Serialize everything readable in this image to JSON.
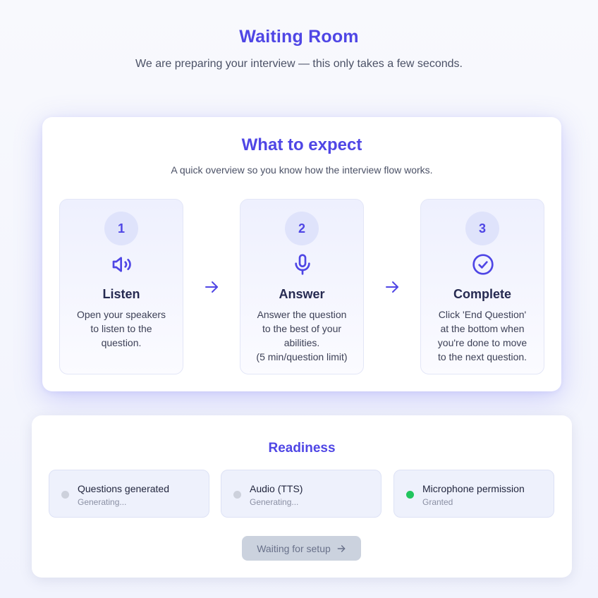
{
  "header": {
    "title": "Waiting Room",
    "subtitle": "We are preparing your interview — this only takes a few seconds."
  },
  "expect": {
    "title": "What to expect",
    "subtitle": "A quick overview so you know how the interview flow works.",
    "steps": [
      {
        "number": "1",
        "icon": "speaker-icon",
        "title": "Listen",
        "description": "Open your speakers\nto listen to the\nquestion."
      },
      {
        "number": "2",
        "icon": "microphone-icon",
        "title": "Answer",
        "description": "Answer the question\nto the best of your\nabilities.\n(5 min/question limit)"
      },
      {
        "number": "3",
        "icon": "check-circle-icon",
        "title": "Complete",
        "description": "Click 'End Question'\nat the bottom when\nyou're done to move\nto the next question."
      }
    ]
  },
  "readiness": {
    "title": "Readiness",
    "items": [
      {
        "label": "Questions generated",
        "status": "Generating...",
        "state": "pending"
      },
      {
        "label": "Audio (TTS)",
        "status": "Generating...",
        "state": "pending"
      },
      {
        "label": "Microphone permission",
        "status": "Granted",
        "state": "done"
      }
    ],
    "button_label": "Waiting for setup"
  },
  "colors": {
    "accent": "#4f46e5",
    "pending": "#cdd1dc",
    "success": "#22c55e"
  }
}
